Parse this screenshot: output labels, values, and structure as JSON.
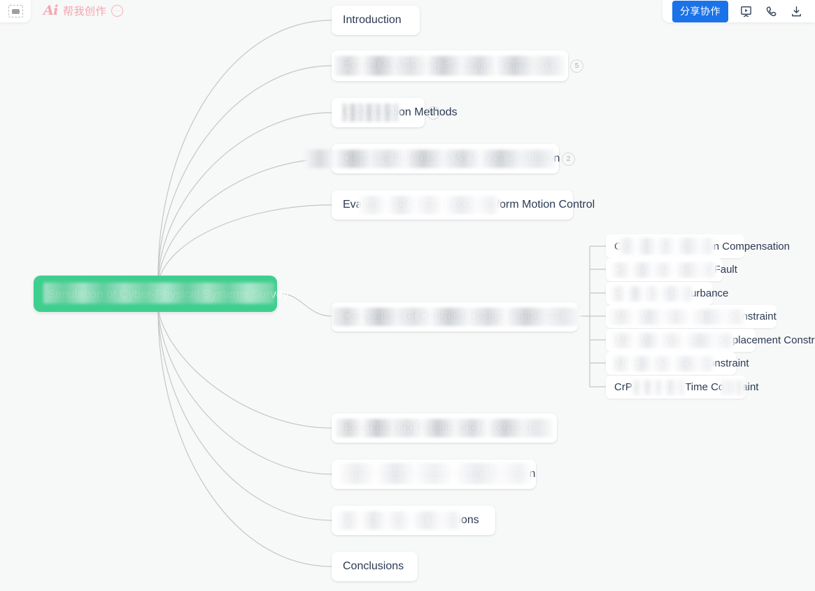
{
  "app": {
    "topleft_icon": "frame-select-icon",
    "ai_mark": "Ai",
    "ai_label": "帮我创作",
    "ai_more": "···"
  },
  "toolbar": {
    "share_label": "分享协作",
    "icons": [
      {
        "name": "presentation-icon",
        "title": "演示"
      },
      {
        "name": "phone-icon",
        "title": "通话"
      },
      {
        "name": "download-icon",
        "title": "下载"
      }
    ]
  },
  "mindmap": {
    "root": {
      "text": "Simulation of Cyber-Physical Systems Survey",
      "redacted": true,
      "color": "#3ecf8e"
    },
    "branches": [
      {
        "text": "Introduction",
        "redacted": false,
        "badge": null
      },
      {
        "text": "Formal Models and Simulation Frameworks",
        "redacted": true,
        "badge": "5"
      },
      {
        "text": "Co-simulation Methods",
        "redacted": true,
        "badge": "8"
      },
      {
        "text": "Objective Formulation for Motion Simulation",
        "redacted": true,
        "badge": "2"
      },
      {
        "text": "Evaluation of Closed-Loop Platform Motion Control",
        "redacted": true,
        "badge": null
      },
      {
        "text": "Comparison of Controller Design Paradigms",
        "redacted": true,
        "badge": null
      },
      {
        "text": "Benchmarking Results and Discussion",
        "redacted": true,
        "badge": null
      },
      {
        "text": "Performance Evaluation and Validation",
        "redacted": true,
        "badge": null
      },
      {
        "text": "Future Research Directions",
        "redacted": true,
        "badge": null
      },
      {
        "text": "Conclusions",
        "redacted": false,
        "badge": null
      }
    ],
    "subnodes": [
      {
        "text": "Control with Prediction Compensation",
        "redacted": true
      },
      {
        "text": "Control with Actuator Fault",
        "redacted": true
      },
      {
        "text": "Control with Disturbance",
        "redacted": true
      },
      {
        "text": "MPC with Actuator Rate Constraint",
        "redacted": true
      },
      {
        "text": "MPC with Workspace Displacement Constraint",
        "redacted": true
      },
      {
        "text": "MPC with Velocity Constraint",
        "redacted": true
      },
      {
        "text": "CrP with Finite Time Constraint",
        "redacted": true
      }
    ]
  },
  "colors": {
    "accent_blue": "#1a73e8",
    "root_green": "#3ecf8e",
    "ai_pink": "#f4a6ae",
    "canvas": "#f7f8f8",
    "node_text": "#2b3a52",
    "edge": "#c4c6c8"
  }
}
